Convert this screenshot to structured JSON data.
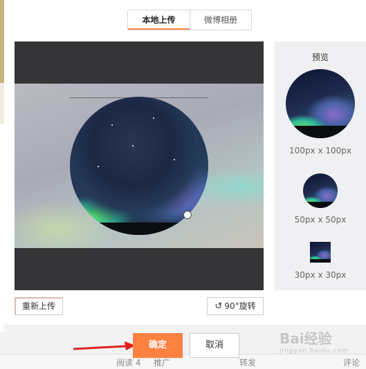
{
  "tabs": [
    {
      "label": "本地上传",
      "active": true
    },
    {
      "label": "微博相册",
      "active": false
    }
  ],
  "preview": {
    "title": "预览",
    "sizes": [
      {
        "label": "100px x 100px"
      },
      {
        "label": "50px x 50px"
      },
      {
        "label": "30px x 30px"
      }
    ]
  },
  "actions": {
    "reupload_label": "重新上传",
    "rotate_label": "90°旋转",
    "rotate_icon": "rotate-ccw-icon"
  },
  "footer": {
    "confirm_label": "确定",
    "cancel_label": "取消"
  },
  "background_page": {
    "bottom_items": [
      "阅读 4",
      "推广",
      "转发",
      "评论"
    ]
  },
  "watermark": {
    "text": "Bai经验",
    "sub": "jingyan.baidu.com"
  },
  "colors": {
    "accent": "#ff8140",
    "editor_bg": "#353436",
    "preview_bg": "#f0f0f3"
  }
}
